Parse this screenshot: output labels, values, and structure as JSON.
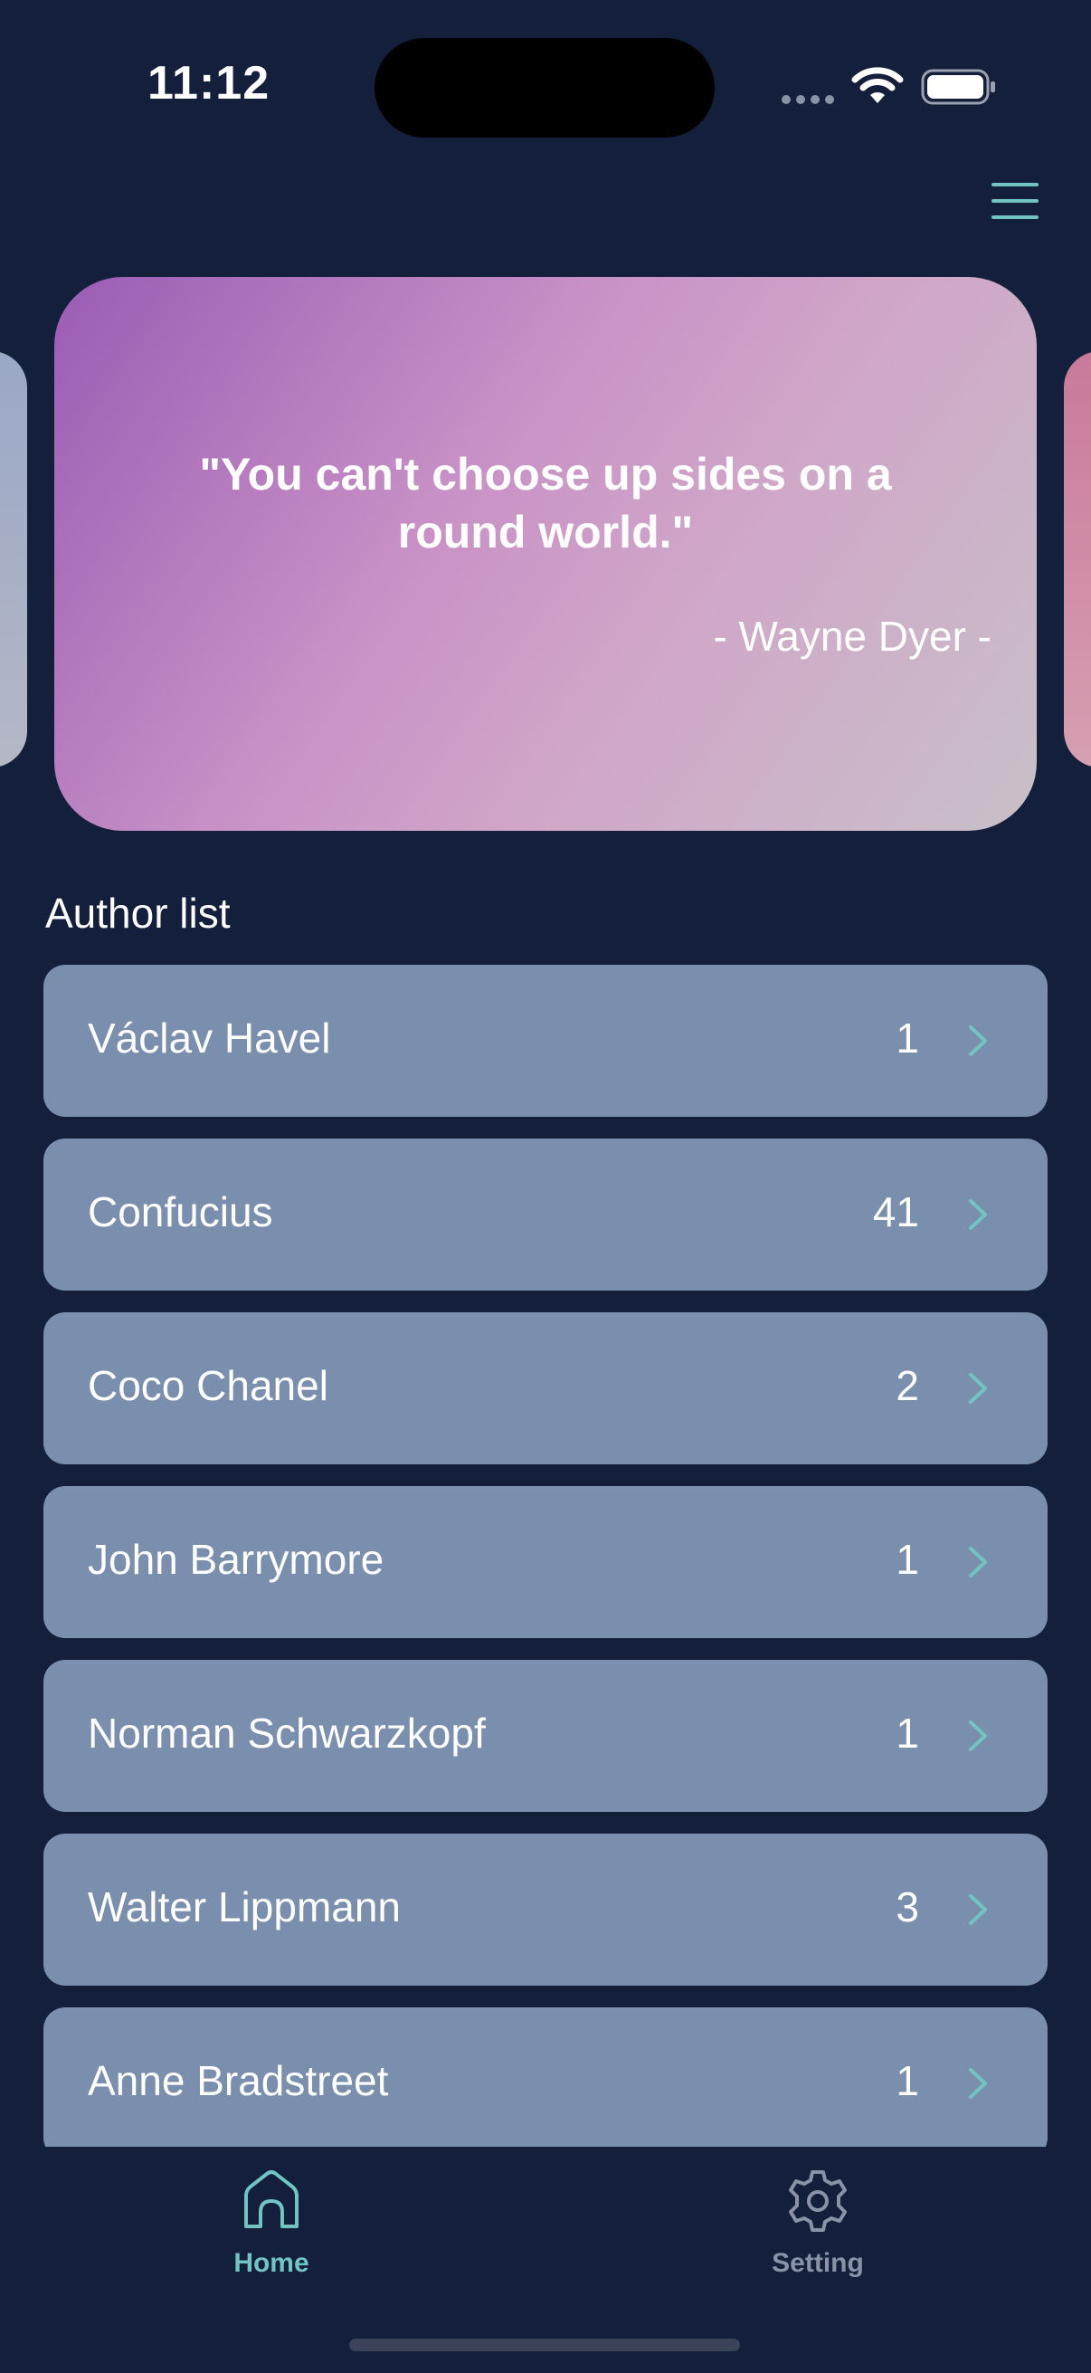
{
  "status_bar": {
    "time": "11:12"
  },
  "header": {
    "menu_icon": "hamburger-menu-icon"
  },
  "carousel": {
    "quote": "\"You can't choose up sides on a round world.\"",
    "author": "- Wayne Dyer -"
  },
  "author_list": {
    "title": "Author list",
    "items": [
      {
        "name": "Václav Havel",
        "count": "1"
      },
      {
        "name": "Confucius",
        "count": "41"
      },
      {
        "name": "Coco Chanel",
        "count": "2"
      },
      {
        "name": "John Barrymore",
        "count": "1"
      },
      {
        "name": "Norman Schwarzkopf",
        "count": "1"
      },
      {
        "name": "Walter Lippmann",
        "count": "3"
      },
      {
        "name": "Anne Bradstreet",
        "count": "1"
      }
    ]
  },
  "tab_bar": {
    "tabs": [
      {
        "label": "Home",
        "icon": "home-icon",
        "active": true
      },
      {
        "label": "Setting",
        "icon": "gear-icon",
        "active": false
      }
    ]
  },
  "colors": {
    "background": "#131f3b",
    "list_item": "#7a8ead",
    "accent": "#72c4c2",
    "inactive_tab": "#8a93a6"
  }
}
